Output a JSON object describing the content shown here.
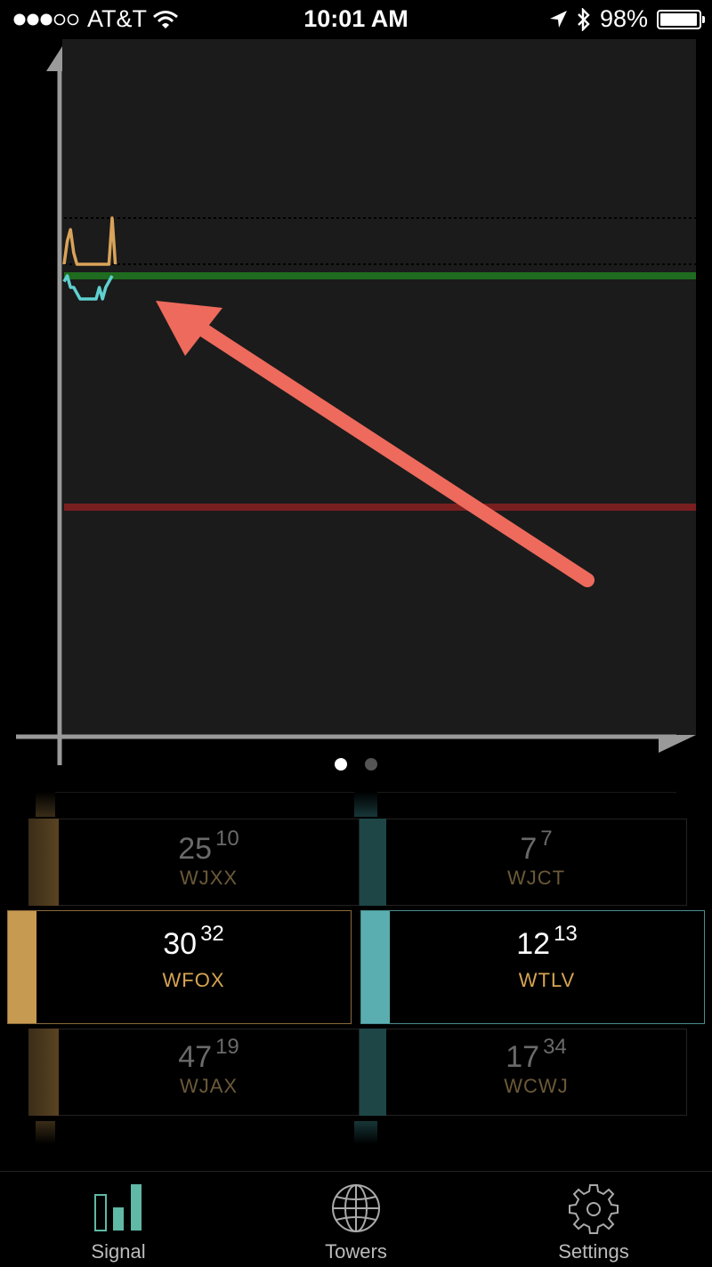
{
  "status_bar": {
    "carrier": "AT&T",
    "time": "10:01 AM",
    "battery": "98%",
    "battery_level": 0.98
  },
  "chart_data": {
    "type": "line",
    "series": [
      {
        "color": "#d9a35a",
        "values": [
          -4,
          -2,
          -1,
          -3,
          -4,
          -4,
          -4,
          -4,
          -4,
          -4,
          -4,
          -4,
          -4,
          -4,
          -4,
          0,
          -4
        ]
      },
      {
        "color": "#5fd0d0",
        "values": [
          -5.5,
          -5,
          -6,
          -6,
          -6.5,
          -7,
          -7,
          -7,
          -7,
          -7,
          -7,
          -6,
          -7,
          -6,
          -5.5,
          -5
        ]
      }
    ],
    "reference_lines": [
      {
        "color": "#1f6b1f",
        "value": -5
      },
      {
        "color": "#7a1f1f",
        "value": -25
      }
    ],
    "dashed_lines": [
      0,
      -4
    ]
  },
  "pager": {
    "page_count": 2,
    "active_index": 0
  },
  "picker": {
    "left_color": "#c79a52",
    "right_color": "#5aaeb0",
    "above": [
      {
        "left": {
          "value": "25",
          "sup": "10",
          "name": "WJXX"
        },
        "right": {
          "value": "7",
          "sup": "7",
          "name": "WJCT"
        }
      }
    ],
    "selected": {
      "left": {
        "value": "30",
        "sup": "32",
        "name": "WFOX"
      },
      "right": {
        "value": "12",
        "sup": "13",
        "name": "WTLV"
      }
    },
    "below": [
      {
        "left": {
          "value": "47",
          "sup": "19",
          "name": "WJAX"
        },
        "right": {
          "value": "17",
          "sup": "34",
          "name": "WCWJ"
        }
      }
    ]
  },
  "tabs": [
    {
      "label": "Signal",
      "icon": "signal-bars-icon",
      "active": true
    },
    {
      "label": "Towers",
      "icon": "globe-icon",
      "active": false
    },
    {
      "label": "Settings",
      "icon": "gear-icon",
      "active": false
    }
  ],
  "accent": "#5fb9a5"
}
